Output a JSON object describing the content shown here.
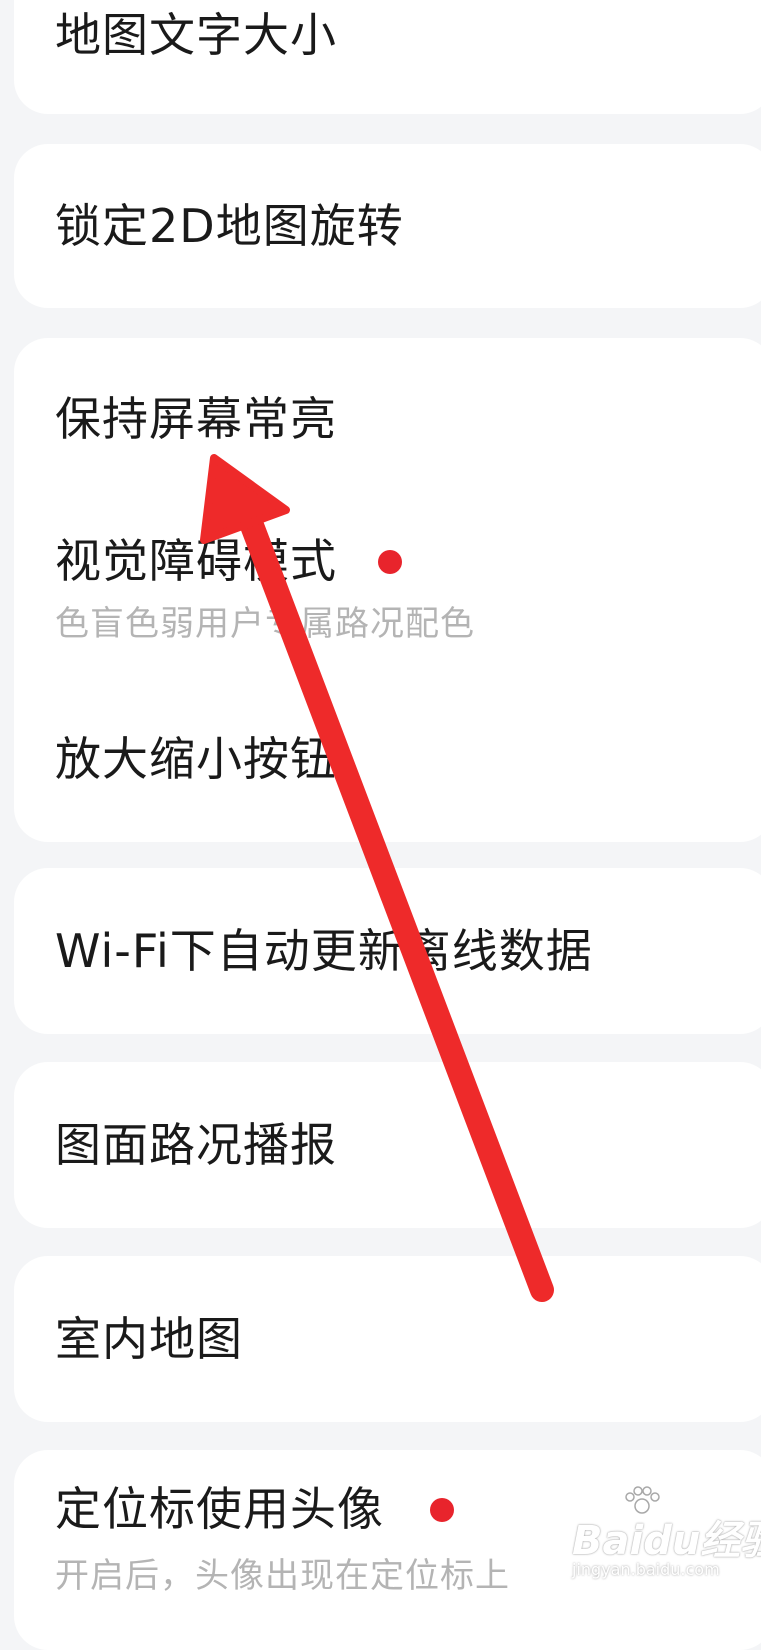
{
  "settings": {
    "items": [
      {
        "label": "地图文字大小"
      },
      {
        "label": "锁定2D地图旋转"
      },
      {
        "label": "保持屏幕常亮"
      },
      {
        "label": "视觉障碍模式",
        "sublabel": "色盲色弱用户专属路况配色",
        "new_dot": true
      },
      {
        "label": "放大缩小按钮"
      },
      {
        "label": "Wi-Fi下自动更新离线数据"
      },
      {
        "label": "图面路况播报"
      },
      {
        "label": "室内地图"
      },
      {
        "label": "定位标使用头像",
        "sublabel": "开启后，头像出现在定位标上",
        "new_dot": true
      }
    ]
  },
  "annotation": {
    "type": "arrow",
    "color": "#ee2a2a"
  },
  "watermark": {
    "brand": "Baidu经验",
    "url": "jingyan.baidu.com"
  },
  "colors": {
    "background": "#f4f5f7",
    "card": "#ffffff",
    "text": "#1a1a1a",
    "subtext": "#b4b4b4",
    "dot": "#e8242c"
  }
}
